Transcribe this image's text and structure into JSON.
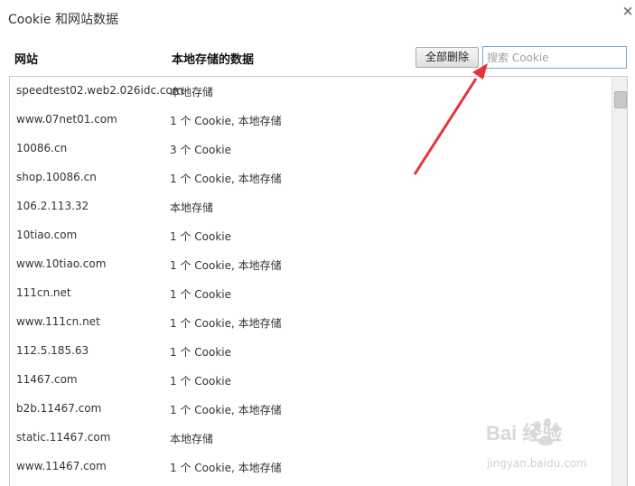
{
  "dialog": {
    "title": "Cookie 和网站数据",
    "close_icon": "close-icon",
    "close_label": "×"
  },
  "header": {
    "site_col": "网站",
    "data_col": "本地存储的数据",
    "delete_all_label": "全部删除",
    "search_placeholder": "搜索 Cookie"
  },
  "rows": [
    {
      "site": "speedtest02.web2.026idc.com",
      "data": "本地存储"
    },
    {
      "site": "www.07net01.com",
      "data": "1 个 Cookie, 本地存储"
    },
    {
      "site": "10086.cn",
      "data": "3 个 Cookie"
    },
    {
      "site": "shop.10086.cn",
      "data": "1 个 Cookie, 本地存储"
    },
    {
      "site": "106.2.113.32",
      "data": "本地存储"
    },
    {
      "site": "10tiao.com",
      "data": "1 个 Cookie"
    },
    {
      "site": "www.10tiao.com",
      "data": "1 个 Cookie, 本地存储"
    },
    {
      "site": "111cn.net",
      "data": "1 个 Cookie"
    },
    {
      "site": "www.111cn.net",
      "data": "1 个 Cookie, 本地存储"
    },
    {
      "site": "112.5.185.63",
      "data": "1 个 Cookie"
    },
    {
      "site": "11467.com",
      "data": "1 个 Cookie"
    },
    {
      "site": "b2b.11467.com",
      "data": "1 个 Cookie, 本地存储"
    },
    {
      "site": "static.11467.com",
      "data": "本地存储"
    },
    {
      "site": "www.11467.com",
      "data": "1 个 Cookie, 本地存储"
    }
  ],
  "annotation": {
    "color": "#e8323a"
  },
  "watermark": {
    "logo": "Bai  经验",
    "url": "jingyan.baidu.com"
  }
}
